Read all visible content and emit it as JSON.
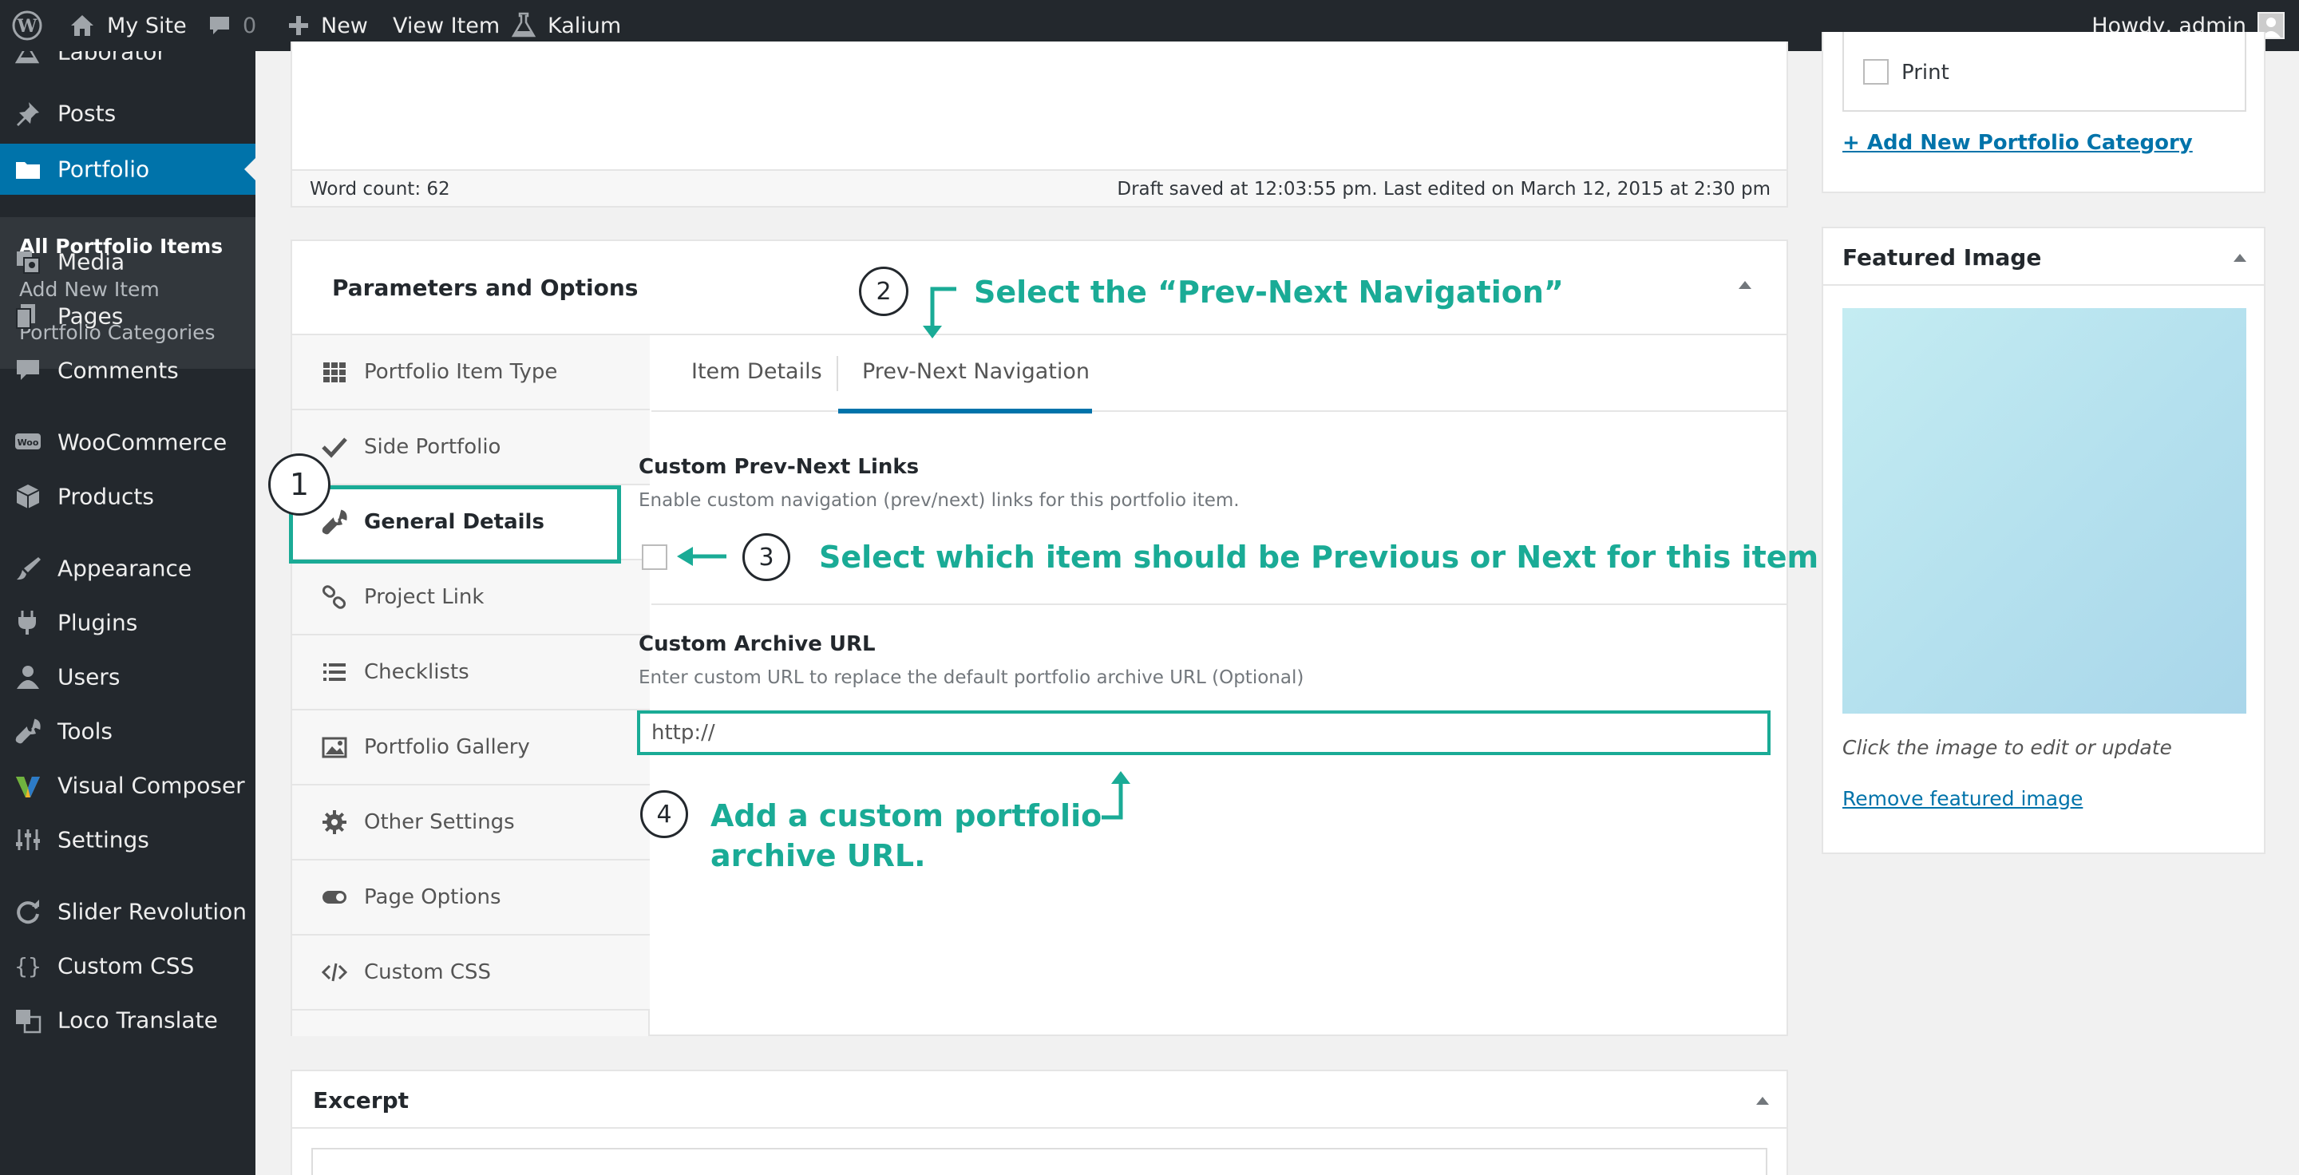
{
  "adminbar": {
    "site_name": "My Site",
    "comments_count": "0",
    "new_label": "New",
    "view_item_label": "View Item",
    "theme_label": "Kalium",
    "greeting": "Howdy, admin"
  },
  "menu": {
    "items": [
      {
        "label": "Laborator",
        "icon": "flask-icon"
      },
      {
        "label": "Posts",
        "icon": "pin-icon"
      },
      {
        "label": "Portfolio",
        "icon": "folder-icon",
        "current": true
      },
      {
        "label": "Media",
        "icon": "media-icon"
      },
      {
        "label": "Pages",
        "icon": "pages-icon"
      },
      {
        "label": "Comments",
        "icon": "comment-icon"
      },
      {
        "label": "WooCommerce",
        "icon": "woo-icon"
      },
      {
        "label": "Products",
        "icon": "cube-icon"
      },
      {
        "label": "Appearance",
        "icon": "brush-icon"
      },
      {
        "label": "Plugins",
        "icon": "plug-icon"
      },
      {
        "label": "Users",
        "icon": "user-icon"
      },
      {
        "label": "Tools",
        "icon": "wrench-icon"
      },
      {
        "label": "Visual Composer",
        "icon": "vc-icon"
      },
      {
        "label": "Settings",
        "icon": "settings-icon"
      },
      {
        "label": "Slider Revolution",
        "icon": "refresh-icon"
      },
      {
        "label": "Custom CSS",
        "icon": "braces-icon"
      },
      {
        "label": "Loco Translate",
        "icon": "translate-icon"
      }
    ],
    "submenu": [
      "All Portfolio Items",
      "Add New Item",
      "Portfolio Categories"
    ]
  },
  "editor": {
    "word_count": "Word count: 62",
    "status": "Draft saved at 12:03:55 pm. Last edited on March 12, 2015 at 2:30 pm"
  },
  "params": {
    "title": "Parameters and Options",
    "side_tabs": [
      {
        "label": "Portfolio Item Type",
        "icon": "grid-icon"
      },
      {
        "label": "Side Portfolio",
        "icon": "checkmark-icon"
      },
      {
        "label": "General Details",
        "icon": "wrench-icon",
        "active": true
      },
      {
        "label": "Project Link",
        "icon": "link-icon"
      },
      {
        "label": "Checklists",
        "icon": "list-icon"
      },
      {
        "label": "Portfolio Gallery",
        "icon": "image-icon"
      },
      {
        "label": "Other Settings",
        "icon": "gear-icon"
      },
      {
        "label": "Page Options",
        "icon": "toggle-icon"
      },
      {
        "label": "Custom CSS",
        "icon": "code-icon"
      }
    ],
    "top_tabs": [
      "Item Details",
      "Prev-Next Navigation"
    ],
    "custom_links_title": "Custom Prev-Next Links",
    "custom_links_desc": "Enable custom navigation (prev/next) links for this portfolio item.",
    "archive_title": "Custom Archive URL",
    "archive_desc": "Enter custom URL to replace the default portfolio archive URL (Optional)",
    "archive_value": "http://"
  },
  "annotations": {
    "n1": "1",
    "n2": "2",
    "n3": "3",
    "n4": "4",
    "a2": "Select the “Prev-Next Navigation”",
    "a3": "Select which item should be Previous or Next for this item",
    "a4_line1": "Add a custom portfolio",
    "a4_line2": "archive URL.",
    "color": "#1aab96"
  },
  "excerpt": {
    "title": "Excerpt"
  },
  "categories": {
    "print_label": "Print",
    "add_new": "+ Add New Portfolio Category"
  },
  "featured": {
    "title": "Featured Image",
    "hint": "Click the image to edit or update",
    "remove": "Remove featured image"
  }
}
